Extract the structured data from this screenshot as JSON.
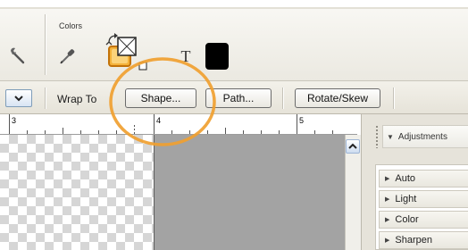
{
  "toolbar": {
    "colors_label": "Colors",
    "tools": {
      "wrench": "wrench-icon",
      "eyedropper": "eyedropper-icon",
      "swap_colors": "swap-colors-icon",
      "text": "text-tool-icon",
      "text_glyph": "T",
      "color_swatch": "color-swatch-icon"
    },
    "foreground_color": "#000000",
    "accent_color": "#e08a12"
  },
  "wrap_toolbar": {
    "wrap_label": "Wrap To",
    "buttons": {
      "shape": "Shape...",
      "path": "Path...",
      "rotate": "Rotate/Skew"
    },
    "highlight_color": "#f0a030"
  },
  "ruler": {
    "labels": [
      "3",
      "4",
      "5"
    ]
  },
  "palette": {
    "title": "Adjustments",
    "items": [
      "Auto",
      "Light",
      "Color",
      "Sharpen"
    ]
  }
}
